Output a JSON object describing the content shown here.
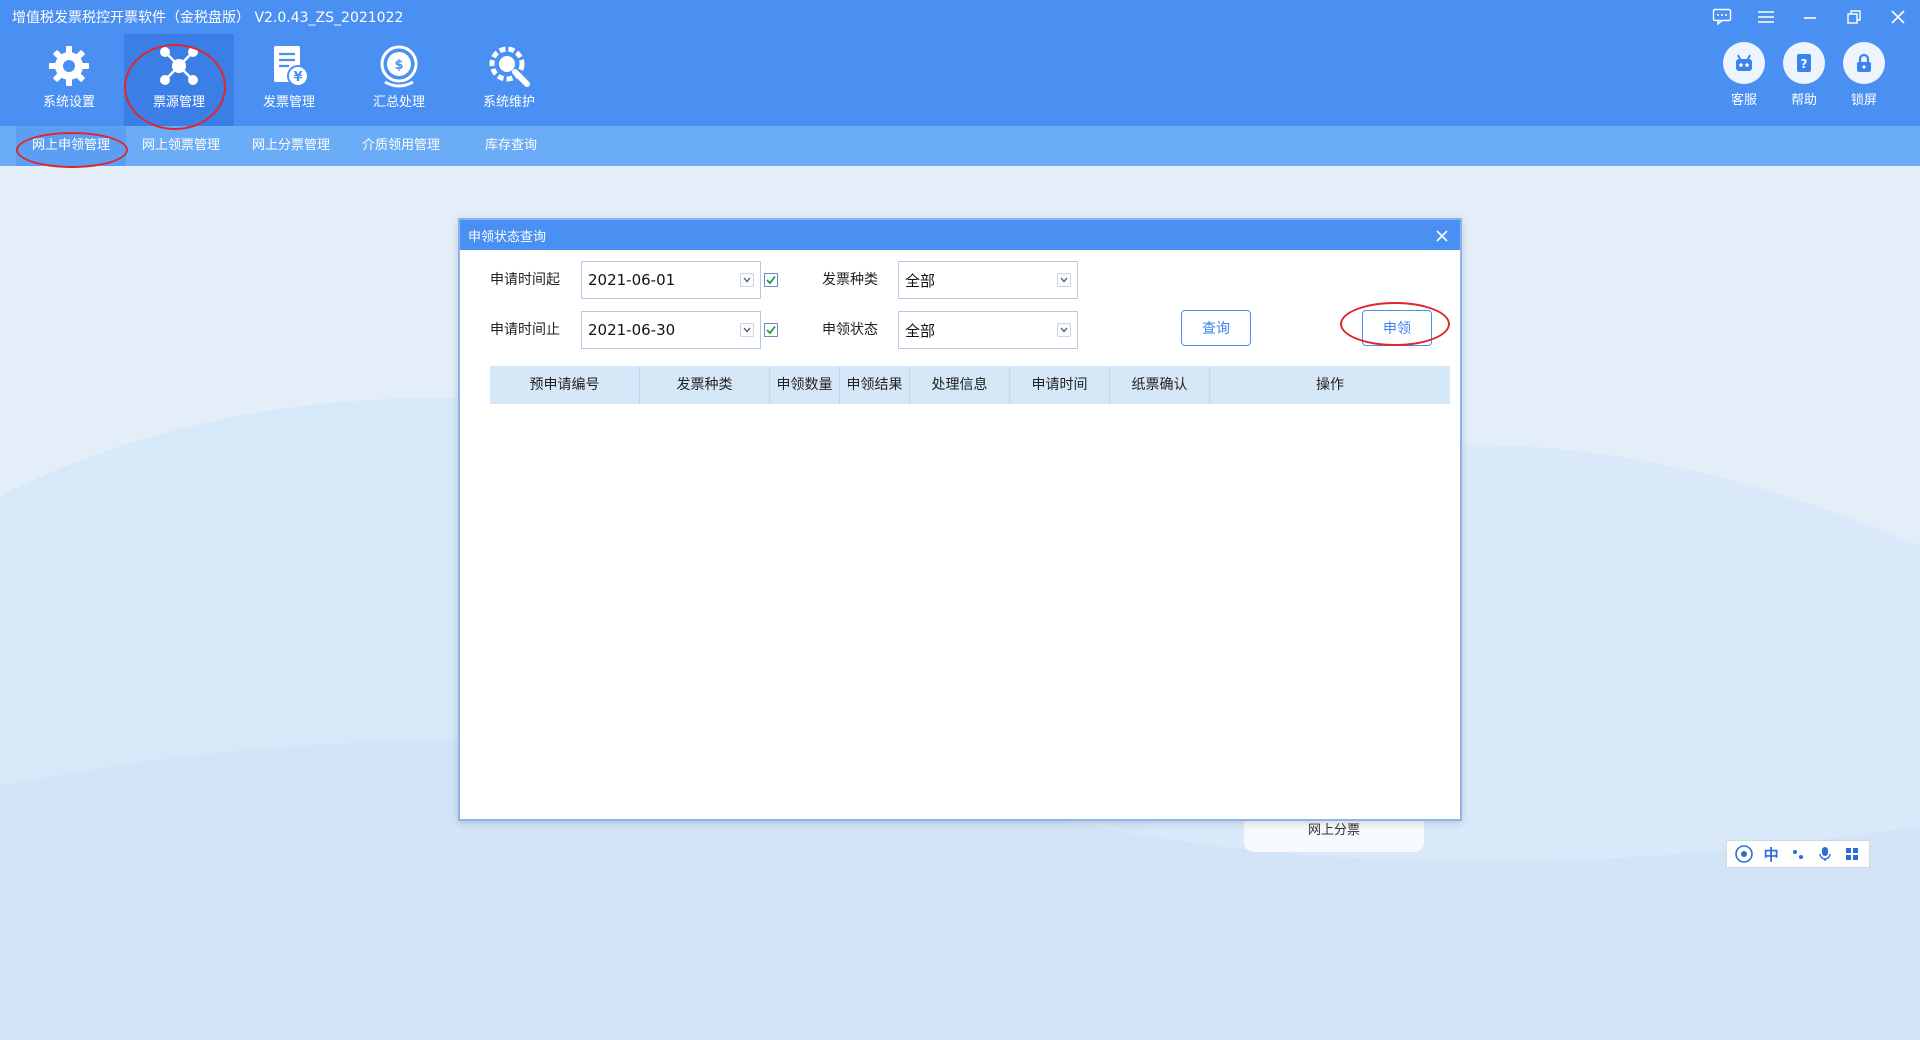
{
  "app": {
    "title": "增值税发票税控开票软件（金税盘版） V2.0.43_ZS_2021022",
    "colors": {
      "primary": "#4a8ff2",
      "subnav": "#6aacf6",
      "highlight": "#e0262c"
    }
  },
  "window_controls": [
    {
      "name": "message-icon"
    },
    {
      "name": "menu-icon"
    },
    {
      "name": "minimize-icon"
    },
    {
      "name": "restore-icon"
    },
    {
      "name": "close-icon"
    }
  ],
  "modules": [
    {
      "label": "系统设置",
      "icon": "gear-icon"
    },
    {
      "label": "票源管理",
      "icon": "network-icon",
      "active": true
    },
    {
      "label": "发票管理",
      "icon": "invoice-icon"
    },
    {
      "label": "汇总处理",
      "icon": "tax-summary-icon"
    },
    {
      "label": "系统维护",
      "icon": "wrench-gear-icon"
    }
  ],
  "right_tools": [
    {
      "label": "客服",
      "icon": "robot-icon"
    },
    {
      "label": "帮助",
      "icon": "help-icon"
    },
    {
      "label": "锁屏",
      "icon": "lock-icon"
    }
  ],
  "subnav": [
    {
      "label": "网上申领管理",
      "active": true
    },
    {
      "label": "网上领票管理"
    },
    {
      "label": "网上分票管理"
    },
    {
      "label": "介质领用管理"
    },
    {
      "label": "库存查询"
    }
  ],
  "background_card": {
    "label": "网上分票"
  },
  "dialog": {
    "title": "申领状态查询",
    "form": {
      "start_date_label": "申请时间起",
      "start_date_value": "2021-06-01",
      "end_date_label": "申请时间止",
      "end_date_value": "2021-06-30",
      "invoice_type_label": "发票种类",
      "invoice_type_value": "全部",
      "apply_status_label": "申领状态",
      "apply_status_value": "全部",
      "start_date_checked": true,
      "end_date_checked": true
    },
    "buttons": {
      "query": "查询",
      "apply": "申领"
    },
    "table": {
      "columns": [
        "预申请编号",
        "发票种类",
        "申领数量",
        "申领结果",
        "处理信息",
        "申请时间",
        "纸票确认",
        "操作"
      ],
      "rows": []
    }
  },
  "ime": {
    "items": [
      "ifly-icon",
      "中",
      "punctuation-icon",
      "mic-icon",
      "grid-icon"
    ],
    "lang": "中"
  }
}
